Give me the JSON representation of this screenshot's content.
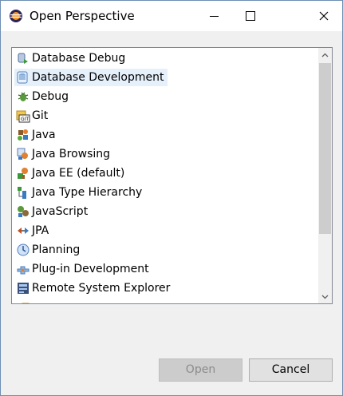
{
  "window": {
    "title": "Open Perspective",
    "icon": "eclipse-icon"
  },
  "list": {
    "selected_index": 1,
    "items": [
      {
        "label": "Database Debug",
        "icon": "database-debug-icon"
      },
      {
        "label": "Database Development",
        "icon": "database-development-icon"
      },
      {
        "label": "Debug",
        "icon": "debug-bug-icon"
      },
      {
        "label": "Git",
        "icon": "git-icon"
      },
      {
        "label": "Java",
        "icon": "java-icon"
      },
      {
        "label": "Java Browsing",
        "icon": "java-browsing-icon"
      },
      {
        "label": "Java EE (default)",
        "icon": "java-ee-icon"
      },
      {
        "label": "Java Type Hierarchy",
        "icon": "java-type-hierarchy-icon"
      },
      {
        "label": "JavaScript",
        "icon": "javascript-icon"
      },
      {
        "label": "JPA",
        "icon": "jpa-icon"
      },
      {
        "label": "Planning",
        "icon": "planning-icon"
      },
      {
        "label": "Plug-in Development",
        "icon": "plugin-icon"
      },
      {
        "label": "Remote System Explorer",
        "icon": "remote-system-icon"
      },
      {
        "label": "",
        "icon": "folder-icon"
      }
    ]
  },
  "buttons": {
    "open_label": "Open",
    "cancel_label": "Cancel"
  },
  "colors": {
    "selection": "#e5f0fb",
    "border": "#6f8fb3"
  }
}
